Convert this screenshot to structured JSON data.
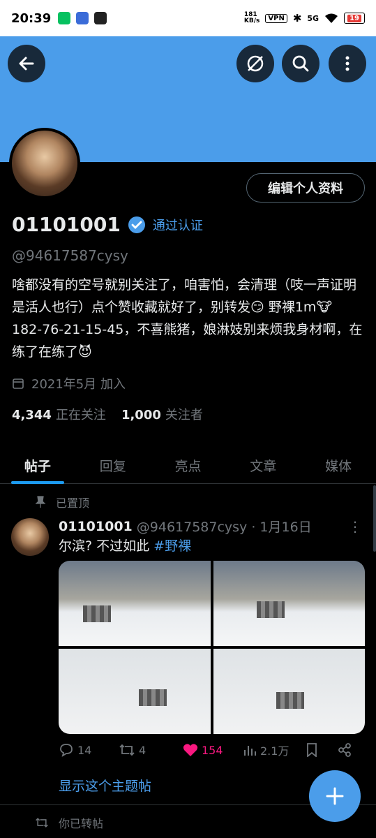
{
  "status_bar": {
    "time": "20:39",
    "net_speed": "181\nKB/s",
    "vpn": "VPN",
    "signal": "5G",
    "battery": "19"
  },
  "header": {
    "back_icon": "arrow-left-icon",
    "explore_icon": "compass-icon",
    "search_icon": "search-icon",
    "more_icon": "more-vertical-icon"
  },
  "profile": {
    "edit_button": "编辑个人资料",
    "name": "01101001",
    "verify_link": "通过认证",
    "handle": "@94617587cysy",
    "bio": "啥都没有的空号就别关注了，咱害怕，会清理（吱一声证明是活人也行）点个赞收藏就好了，别转发😏 野裸1m🐮 182-76-21-15-45，不喜熊猪，娘淋妓别来烦我身材啊，在练了在练了😈",
    "joined": "2021年5月 加入",
    "following_count": "4,344",
    "following_label": "正在关注",
    "followers_count": "1,000",
    "followers_label": "关注者"
  },
  "tabs": [
    {
      "label": "帖子",
      "active": true
    },
    {
      "label": "回复",
      "active": false
    },
    {
      "label": "亮点",
      "active": false
    },
    {
      "label": "文章",
      "active": false
    },
    {
      "label": "媒体",
      "active": false
    }
  ],
  "pinned_post": {
    "pinned_label": "已置顶",
    "name": "01101001",
    "meta": "@94617587cysy · 1月16日",
    "text": "尔滨? 不过如此 ",
    "hashtag": "#野裸",
    "replies": "14",
    "retweets": "4",
    "likes": "154",
    "views": "2.1万",
    "show_thread": "显示这个主题帖"
  },
  "next_post": {
    "retweeted_label": "你已转帖"
  },
  "colors": {
    "accent": "#1d9bf0",
    "banner": "#4b9dea",
    "like": "#f91880"
  }
}
